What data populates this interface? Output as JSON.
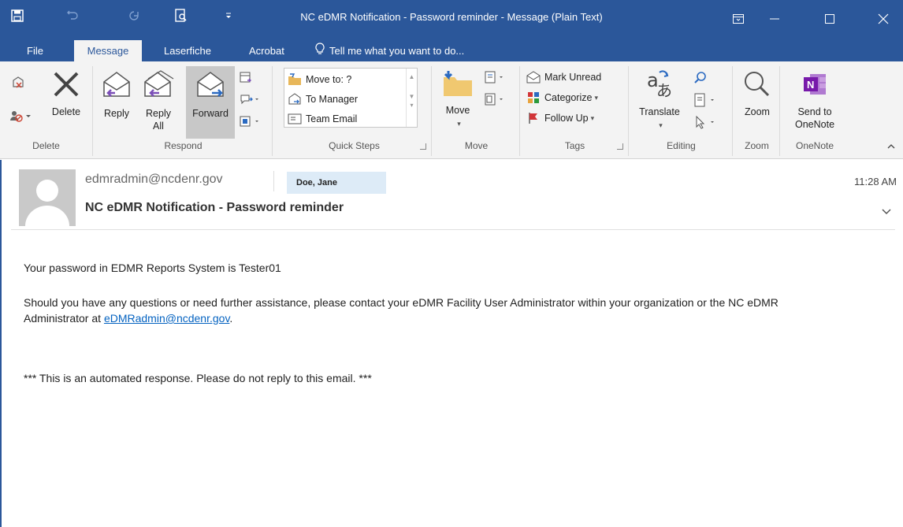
{
  "window": {
    "title": "NC eDMR Notification - Password reminder - Message (Plain Text)"
  },
  "tabs": [
    {
      "label": "File"
    },
    {
      "label": "Message"
    },
    {
      "label": "Laserfiche"
    },
    {
      "label": "Acrobat"
    }
  ],
  "tell_me": "Tell me what you want to do...",
  "ribbon": {
    "delete_group": {
      "label": "Delete",
      "delete_label": "Delete"
    },
    "respond_group": {
      "label": "Respond",
      "reply_label": "Reply",
      "reply_all_line1": "Reply",
      "reply_all_line2": "All",
      "forward_label": "Forward"
    },
    "quick_steps_group": {
      "label": "Quick Steps",
      "items": [
        "Move to: ?",
        "To Manager",
        "Team Email"
      ]
    },
    "move_group": {
      "label": "Move",
      "move_label": "Move"
    },
    "tags_group": {
      "label": "Tags",
      "mark_unread": "Mark Unread",
      "categorize": "Categorize",
      "follow_up": "Follow Up"
    },
    "editing_group": {
      "label": "Editing",
      "translate_label": "Translate"
    },
    "zoom_group": {
      "label": "Zoom",
      "zoom_label": "Zoom"
    },
    "onenote_group": {
      "label": "OneNote",
      "send_line1": "Send to",
      "send_line2": "OneNote"
    }
  },
  "message": {
    "from": "edmradmin@ncdenr.gov",
    "to": "Doe, Jane",
    "subject": "NC eDMR Notification - Password reminder",
    "time": "11:28 AM",
    "body_line1": "Your password in EDMR Reports System is  Tester01",
    "body_para2_text": " Should you have any questions or need further assistance, please contact your eDMR Facility User Administrator within your organization or the NC eDMR Administrator at ",
    "body_link": "eDMRadmin@ncdenr.gov",
    "body_para2_end": ".",
    "body_footer": "*** This is an automated response. Please do not reply to this email. ***"
  },
  "colors": {
    "brand": "#2b579a",
    "ribbon_bg": "#f3f3f3",
    "link": "#0563c1",
    "to_chip": "#ddebf7"
  }
}
